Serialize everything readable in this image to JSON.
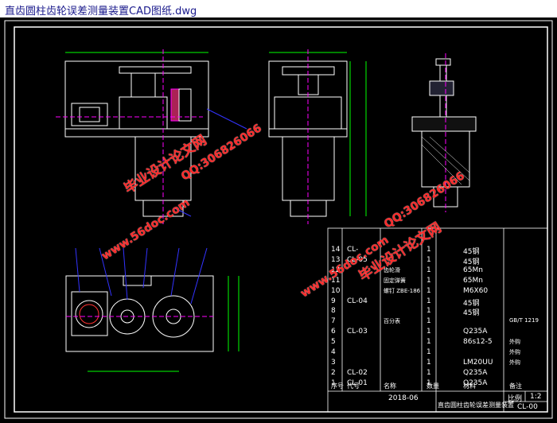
{
  "window": {
    "title": "直齿圆柱齿轮误差测量装置CAD图纸.dwg"
  },
  "watermarks": {
    "site": "www.56doc.com",
    "brand": "毕业设计论文网",
    "qq": "QQ:306826066"
  },
  "bom_rows": [
    {
      "no": "14",
      "code": "CL-",
      "name": "",
      "qty": "1",
      "mat": "45钢",
      "note": ""
    },
    {
      "no": "13",
      "code": "CL-05",
      "name": "",
      "qty": "1",
      "mat": "45钢",
      "note": ""
    },
    {
      "no": "12",
      "code": "",
      "name": "齿轮滑",
      "qty": "1",
      "mat": "65Mn",
      "note": ""
    },
    {
      "no": "11",
      "code": "",
      "name": "固定弹簧",
      "qty": "1",
      "mat": "65Mn",
      "note": ""
    },
    {
      "no": "10",
      "code": "",
      "name": "螺钉 ZBE-186",
      "qty": "1",
      "mat": "M6X60",
      "note": ""
    },
    {
      "no": "9",
      "code": "CL-04",
      "name": "",
      "qty": "1",
      "mat": "45钢",
      "note": ""
    },
    {
      "no": "8",
      "code": "",
      "name": "",
      "qty": "1",
      "mat": "45钢",
      "note": ""
    },
    {
      "no": "7",
      "code": "",
      "name": "百分表",
      "qty": "1",
      "mat": "",
      "note": "GB/T 1219"
    },
    {
      "no": "6",
      "code": "CL-03",
      "name": "",
      "qty": "1",
      "mat": "Q235A",
      "note": ""
    },
    {
      "no": "5",
      "code": "",
      "name": "",
      "qty": "1",
      "mat": "86s12-5",
      "note": "外购"
    },
    {
      "no": "4",
      "code": "",
      "name": "",
      "qty": "1",
      "mat": "",
      "note": "外购"
    },
    {
      "no": "3",
      "code": "",
      "name": "",
      "qty": "1",
      "mat": "LM20UU",
      "note": "外购"
    },
    {
      "no": "2",
      "code": "CL-02",
      "name": "",
      "qty": "1",
      "mat": "Q235A",
      "note": ""
    },
    {
      "no": "1",
      "code": "CL-01",
      "name": "",
      "qty": "1",
      "mat": "Q235A",
      "note": ""
    }
  ],
  "bom_header": {
    "no": "序号",
    "code": "代号",
    "name": "名称",
    "qty": "数量",
    "mat": "材料",
    "note": "备注"
  },
  "title_block": {
    "date": "2018-06",
    "drawing_name": "直齿圆柱齿轮误差测量装置",
    "ratio_label": "比例",
    "ratio": "1:2",
    "drawing_no": "CL-00"
  },
  "colors": {
    "line": "#ffffff",
    "accent": "#00ff00",
    "dim": "#00ffff",
    "hatch": "#ff00ff",
    "leader": "#3333ff",
    "watermark": "#ff2a2a"
  }
}
